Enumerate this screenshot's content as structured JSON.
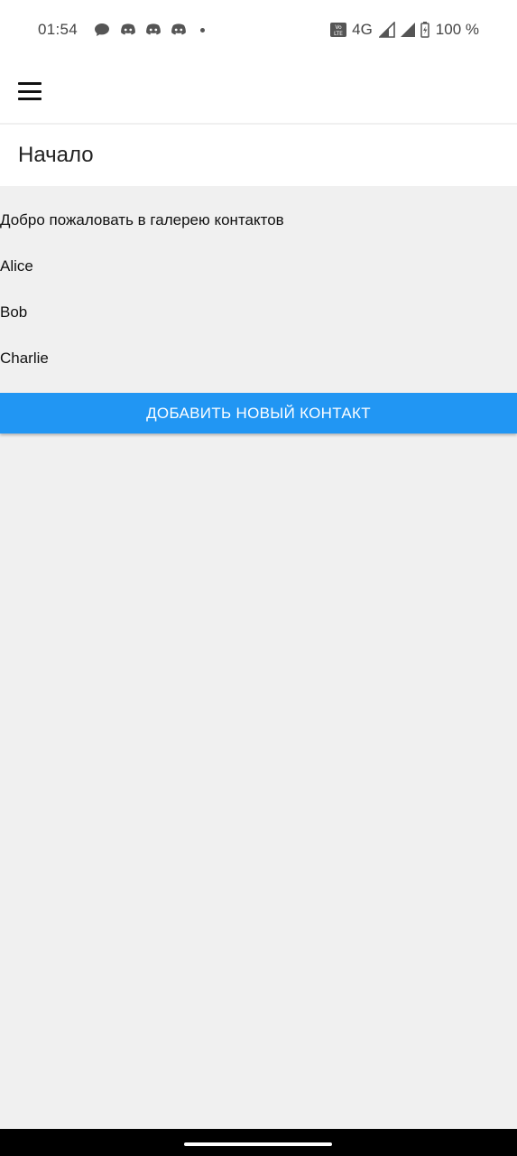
{
  "status_bar": {
    "time": "01:54",
    "notifications": [
      "message-icon",
      "discord-icon",
      "discord-icon",
      "discord-icon"
    ],
    "network": "4G",
    "battery": "100 %"
  },
  "app_bar": {
    "menu_icon": "menu-icon"
  },
  "header": {
    "title": "Начало"
  },
  "main": {
    "welcome_text": "Добро пожаловать в галерею контактов",
    "contacts": [
      "Alice",
      "Bob",
      "Charlie"
    ],
    "add_button_label": "ДОБАВИТЬ НОВЫЙ КОНТАКТ"
  },
  "colors": {
    "accent": "#2196f3",
    "background": "#f0f0f0",
    "surface": "#ffffff"
  }
}
